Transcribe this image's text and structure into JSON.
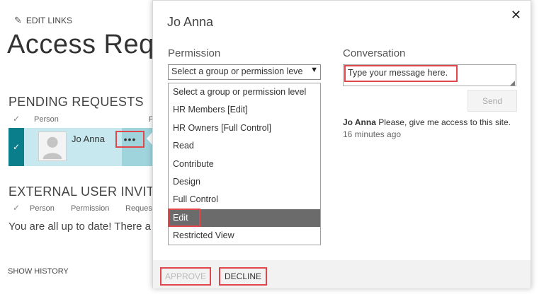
{
  "page": {
    "edit_links": "EDIT LINKS",
    "title": "Access Reque",
    "pending_title": "PENDING REQUESTS",
    "pending_cols": {
      "check": "✓",
      "person": "Person",
      "partial": "F"
    },
    "request": {
      "name": "Jo Anna",
      "more": "•••",
      "check": "✓"
    },
    "external_title": "EXTERNAL USER INVITATI",
    "external_cols": {
      "check": "✓",
      "person": "Person",
      "permission": "Permission",
      "request": "Request"
    },
    "up_to_date": "You are all up to date! There a",
    "show_history": "SHOW HISTORY"
  },
  "dialog": {
    "title": "Jo Anna",
    "close": "✕",
    "permission_label": "Permission",
    "select_value": "Select a group or permission leve",
    "options": [
      "Select a group or permission level",
      "HR Members [Edit]",
      "HR Owners [Full Control]",
      "Read",
      "Contribute",
      "Design",
      "Full Control",
      "Edit",
      "Restricted View"
    ],
    "selected_option": "Edit",
    "conversation_label": "Conversation",
    "message_placeholder": "Type your message here.",
    "send_label": "Send",
    "conversation": {
      "author": "Jo Anna",
      "text": "Please, give me access to this site.",
      "time": "16 minutes ago"
    },
    "approve_label": "APPROVE",
    "decline_label": "DECLINE"
  },
  "colors": {
    "accent": "#0b7e8c",
    "row_highlight": "#c7e8ee",
    "annotation": "#e0464a",
    "selected_option": "#6b6b6b"
  }
}
